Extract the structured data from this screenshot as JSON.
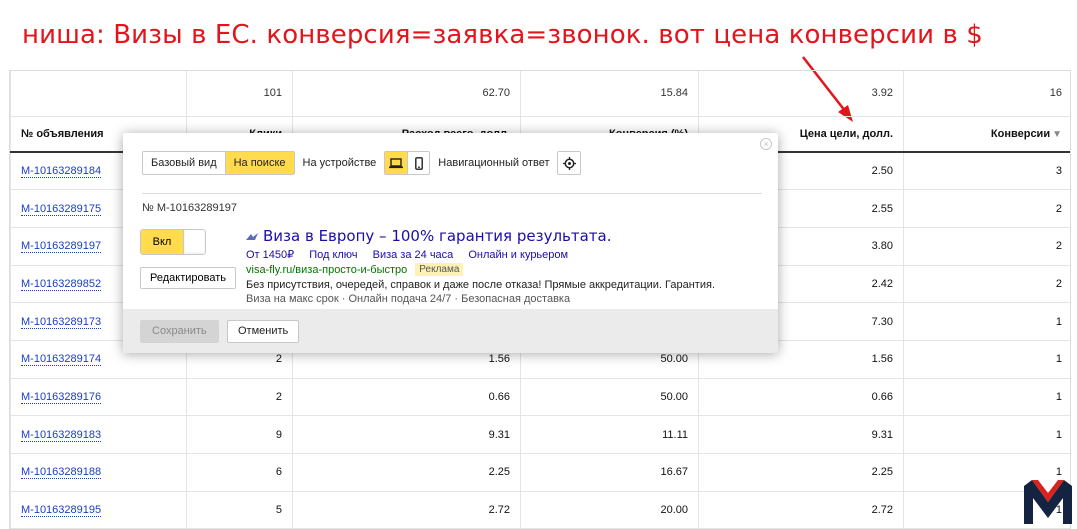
{
  "annotation": {
    "text": "ниша: Визы в ЕС. конверсия=заявка=звонок. вот цена конверсии в $",
    "color": "#e3141b"
  },
  "table": {
    "totals": [
      "",
      "101",
      "62.70",
      "15.84",
      "3.92",
      "16"
    ],
    "headers": [
      "№ объявления",
      "Клики",
      "Расход всего, долл.",
      "Конверсия (%)",
      "Цена цели, долл.",
      "Конверсии"
    ],
    "sort_icon": "triangle-down-icon",
    "rows": [
      [
        "M-10163289184",
        "",
        "",
        "",
        "2.50",
        "3"
      ],
      [
        "M-10163289175",
        "",
        "",
        "",
        "2.55",
        "2"
      ],
      [
        "M-10163289197",
        "",
        "",
        "",
        "3.80",
        "2"
      ],
      [
        "M-10163289852",
        "",
        "",
        "",
        "2.42",
        "2"
      ],
      [
        "M-10163289173",
        "",
        "",
        "",
        "7.30",
        "1"
      ],
      [
        "M-10163289174",
        "2",
        "1.56",
        "50.00",
        "1.56",
        "1"
      ],
      [
        "M-10163289176",
        "2",
        "0.66",
        "50.00",
        "0.66",
        "1"
      ],
      [
        "M-10163289183",
        "9",
        "9.31",
        "11.11",
        "9.31",
        "1"
      ],
      [
        "M-10163289188",
        "6",
        "2.25",
        "16.67",
        "2.25",
        "1"
      ],
      [
        "M-10163289195",
        "5",
        "2.72",
        "20.00",
        "2.72",
        "1"
      ]
    ]
  },
  "popup": {
    "view_basic": "Базовый вид",
    "view_search": "На поиске",
    "on_device_label": "На устройстве",
    "nav_answer_label": "Навигационный ответ",
    "ad_number": "№ M-10163289197",
    "toggle_label": "Вкл",
    "edit_label": "Редактировать",
    "ad": {
      "title": "Виза в Европу – 100% гарантия результата.",
      "sitelinks": [
        "От 1450₽",
        "Под ключ",
        "Виза за 24 часа",
        "Онлайн и курьером"
      ],
      "url": "visa-fly.ru/виза-просто-и-быстро",
      "badge": "Реклама",
      "text": "Без присутствия, очередей, справок и даже после отказа! Прямые аккредитации. Гарантия.",
      "callouts": "Виза на макс срок · Онлайн подача 24/7 · Безопасная доставка"
    },
    "save_label": "Сохранить",
    "cancel_label": "Отменить",
    "accent_color": "#ffdb4d"
  }
}
